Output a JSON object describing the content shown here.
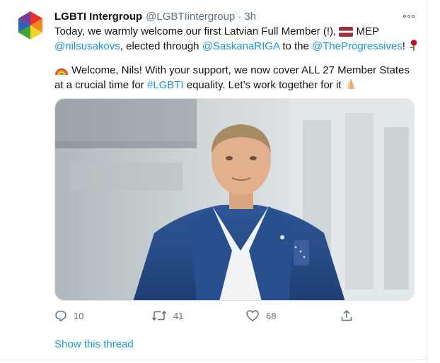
{
  "tweet": {
    "display_name": "LGBTI Intergroup",
    "handle": "@LGBTIintergroup",
    "separator": "·",
    "time": "3h",
    "avatar": "rainbow-hexagon-logo",
    "more_icon": "more-dots-icon",
    "line1": "Today, we warmly welcome our first Latvian Full Member (!),",
    "line1_after_flag": "MEP",
    "mention_nils": "@nilsusakovs",
    "line2_mid": ", elected through",
    "mention_saskana": "@SaskanaRIGA",
    "line2_to": "to the",
    "mention_progressives": "@TheProgressives",
    "line2_end": "!",
    "line3": "Welcome, Nils! With your support, we now cover ALL 27 Member States",
    "line4_start": "at a crucial time for",
    "hashtag": "#LGBTI",
    "line4_end": "equality. Let’s work together for it",
    "emojis": [
      "latvia-flag-icon",
      "rose-icon",
      "rainbow-icon",
      "folded-hands-icon"
    ],
    "image": "photo-man-blue-suit",
    "accent_color": "#1b95e0",
    "muted_color": "#5b7083"
  },
  "actions": {
    "reply_count": "10",
    "retweet_count": "41",
    "like_count": "68",
    "icons": [
      "reply-icon",
      "retweet-icon",
      "like-icon",
      "share-icon"
    ]
  },
  "show_thread": "Show this thread"
}
